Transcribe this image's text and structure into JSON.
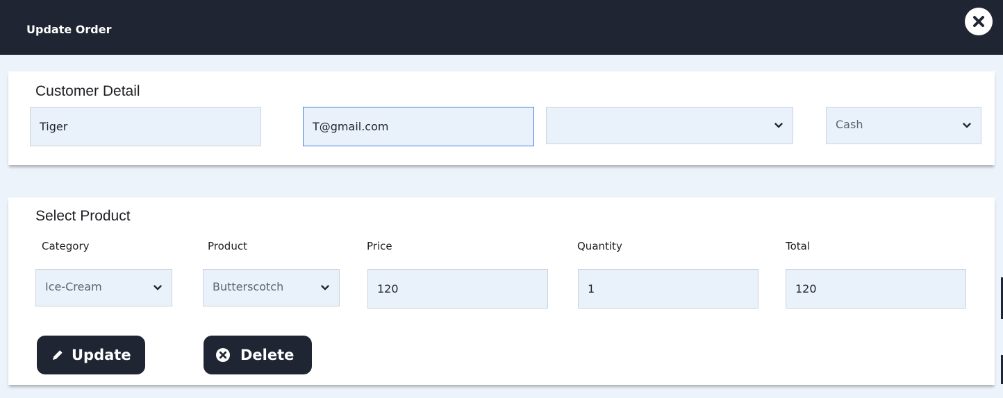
{
  "dialog": {
    "title": "Update Order"
  },
  "customer": {
    "heading": "Customer Detail",
    "name_value": "Tiger",
    "email_value": "T@gmail.com",
    "phone_select_value": "",
    "payment_select_value": "Cash"
  },
  "product": {
    "heading": "Select Product",
    "labels": {
      "category": "Category",
      "product": "Product",
      "price": "Price",
      "quantity": "Quantity",
      "total": "Total"
    },
    "category_value": "Ice-Cream",
    "product_value": "Butterscotch",
    "price_value": "120",
    "quantity_value": "1",
    "total_value": "120"
  },
  "actions": {
    "update_label": "Update",
    "delete_label": "Delete"
  },
  "icons": {
    "close": "close-icon",
    "chevron": "chevron-down-icon",
    "pencil": "pencil-icon",
    "delete": "circle-x-icon"
  },
  "colors": {
    "header_bg": "#1f2532",
    "field_bg": "#e9f1fb",
    "page_bg": "#edf3fb",
    "focus_border": "#4a7ee0"
  }
}
